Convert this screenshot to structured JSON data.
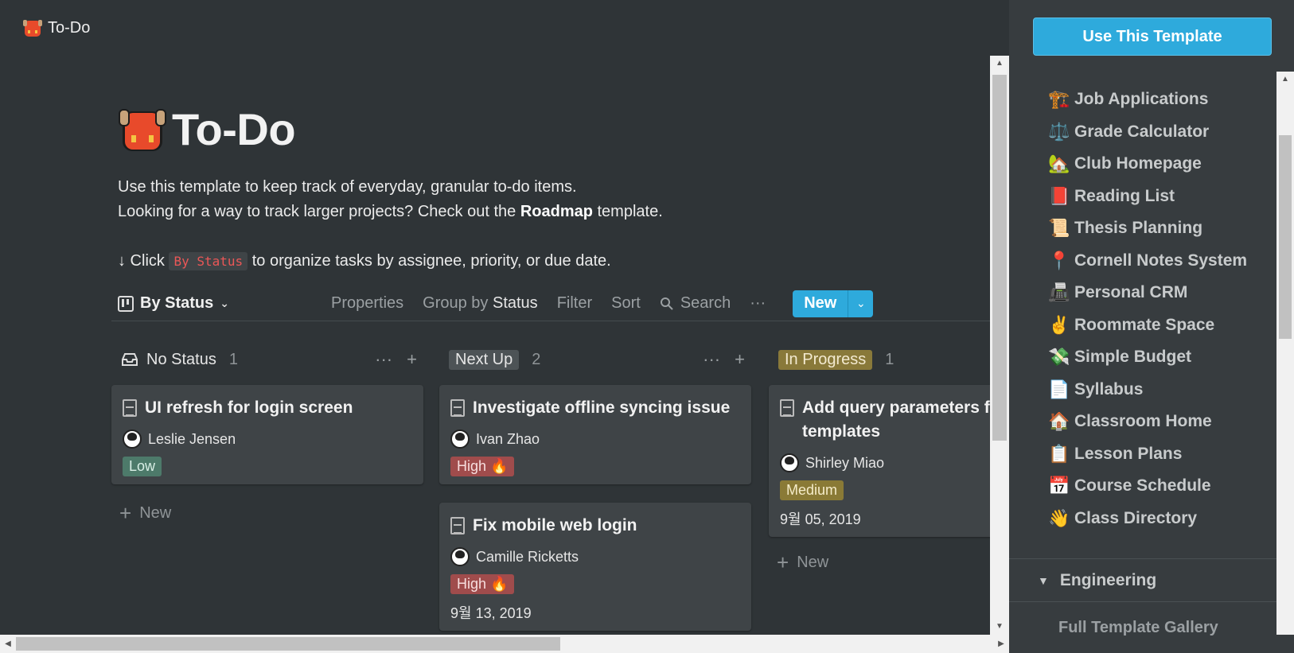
{
  "topbar": {
    "title": "To-Do"
  },
  "page": {
    "title": "To-Do",
    "desc_line1": "Use this template to keep track of everyday, granular to-do items.",
    "desc_line2_pre": "Looking for a way to track larger projects? Check out the ",
    "desc_line2_bold": "Roadmap",
    "desc_line2_post": " template.",
    "desc_line3_pre": "↓ Click ",
    "desc_line3_code": "By Status",
    "desc_line3_post": " to organize tasks by assignee, priority, or due date."
  },
  "toolbar": {
    "view_label": "By Status",
    "properties": "Properties",
    "group_by_label": "Group by ",
    "group_by_value": "Status",
    "filter": "Filter",
    "sort": "Sort",
    "search": "Search",
    "more": "···",
    "new_label": "New"
  },
  "board": {
    "columns": [
      {
        "title": "No Status",
        "count": "1",
        "cards": [
          {
            "title": "UI refresh for login screen",
            "assignee": "Leslie Jensen",
            "priority": "Low"
          }
        ],
        "new_label": "New"
      },
      {
        "title": "Next Up",
        "count": "2",
        "cards": [
          {
            "title": "Investigate offline syncing issue",
            "assignee": "Ivan Zhao",
            "priority": "High 🔥"
          },
          {
            "title": "Fix mobile web login",
            "assignee": "Camille Ricketts",
            "priority": "High 🔥",
            "date": "9월 13, 2019"
          }
        ]
      },
      {
        "title": "In Progress",
        "count": "1",
        "cards": [
          {
            "title": "Add query parameters for templates",
            "assignee": "Shirley Miao",
            "priority": "Medium",
            "date": "9월 05, 2019"
          }
        ],
        "new_label": "New"
      }
    ]
  },
  "sidebar": {
    "use_button": "Use This Template",
    "templates": [
      {
        "icon": "🏗️",
        "label": "Job Applications"
      },
      {
        "icon": "⚖️",
        "label": "Grade Calculator"
      },
      {
        "icon": "🏡",
        "label": "Club Homepage"
      },
      {
        "icon": "📕",
        "label": "Reading List"
      },
      {
        "icon": "📜",
        "label": "Thesis Planning"
      },
      {
        "icon": "📍",
        "label": "Cornell Notes System"
      },
      {
        "icon": "📠",
        "label": "Personal CRM"
      },
      {
        "icon": "✌️",
        "label": "Roommate Space"
      },
      {
        "icon": "💸",
        "label": "Simple Budget"
      },
      {
        "icon": "📄",
        "label": "Syllabus"
      },
      {
        "icon": "🏠",
        "label": "Classroom Home"
      },
      {
        "icon": "📋",
        "label": "Lesson Plans"
      },
      {
        "icon": "📅",
        "label": "Course Schedule"
      },
      {
        "icon": "👋",
        "label": "Class Directory"
      }
    ],
    "section": "Engineering",
    "gallery_link": "Full Template Gallery"
  }
}
